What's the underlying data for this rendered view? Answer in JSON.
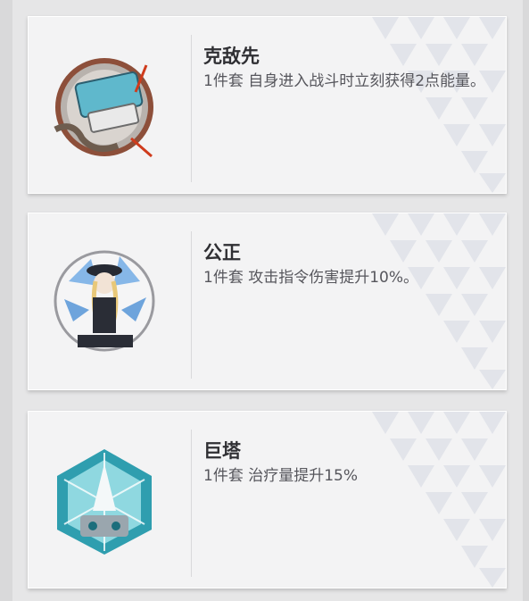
{
  "cards": [
    {
      "name": "克敌先",
      "description": "1件套 自身进入战斗时立刻获得2点能量。",
      "art_icon": "card-art-chained-emblem-icon"
    },
    {
      "name": "公正",
      "description": "1件套 攻击指令伤害提升10%。",
      "art_icon": "card-art-officer-portrait-icon"
    },
    {
      "name": "巨塔",
      "description": "1件套 治疗量提升15%",
      "art_icon": "card-art-crystal-tower-icon"
    }
  ],
  "colors": {
    "card_bg": "#f3f3f4",
    "title": "#2f2f33",
    "text": "#56565c",
    "pattern": "#e2e4e9"
  }
}
